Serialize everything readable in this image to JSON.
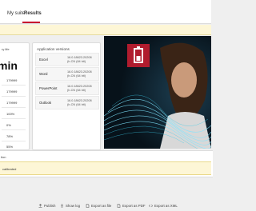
{
  "tabs": {
    "mysuite": "My suite",
    "results": "Results"
  },
  "battery": {
    "title_partial": "ry life",
    "big_partial": "min",
    "rows": [
      "179999",
      "179999",
      "179999",
      "100%",
      "0%",
      "78%",
      "55%"
    ]
  },
  "app_versions": {
    "title": "Application versions",
    "rows": [
      {
        "app": "Excel",
        "version": "16.0.18623.20208\n(h-CN (64 bit)"
      },
      {
        "app": "Word",
        "version": "16.0.18623.20208\n(h-CN (64 bit)"
      },
      {
        "app": "PowerPoint",
        "version": "16.0.18623.20208\n(h-CN (64 bit)"
      },
      {
        "app": "Outlook",
        "version": "16.0.18623.20208\n(h-CN (64 bit)"
      }
    ]
  },
  "bottom": {
    "label_partial": "tion",
    "banner_text": "calibrated"
  },
  "footer": {
    "publish": "Publish",
    "show_log": "Show log",
    "export_file": "Export as file",
    "export_pdf": "Export as PDF",
    "export_xml": "Export as XML"
  },
  "colors": {
    "accent": "#c8102e",
    "banner": "#fdf6d6",
    "logo": "#b01c2e"
  }
}
